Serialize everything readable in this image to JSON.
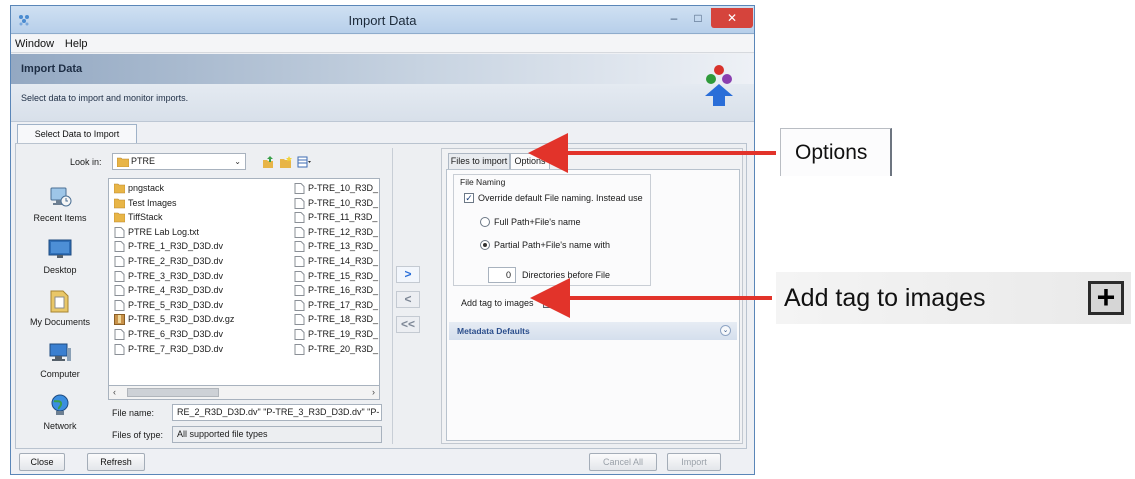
{
  "window": {
    "title": "Import Data",
    "controls": {
      "minimize": "–",
      "maximize": "□",
      "close": "✕"
    }
  },
  "menubar": {
    "items": [
      "Window",
      "Help"
    ]
  },
  "banner": {
    "title": "Import Data",
    "subtitle": "Select data to import and monitor imports."
  },
  "main_tab": {
    "label": "Select Data to Import"
  },
  "chooser": {
    "look_in_label": "Look in:",
    "look_in_value": "PTRE",
    "places": [
      "Recent Items",
      "Desktop",
      "My Documents",
      "Computer",
      "Network"
    ],
    "files_col1": [
      {
        "name": "pngstack",
        "icon": "folder-icon"
      },
      {
        "name": "Test Images",
        "icon": "folder-icon"
      },
      {
        "name": "TiffStack",
        "icon": "folder-icon"
      },
      {
        "name": "PTRE Lab Log.txt",
        "icon": "file-icon"
      },
      {
        "name": "P-TRE_1_R3D_D3D.dv",
        "icon": "file-icon"
      },
      {
        "name": "P-TRE_2_R3D_D3D.dv",
        "icon": "file-icon"
      },
      {
        "name": "P-TRE_3_R3D_D3D.dv",
        "icon": "file-icon"
      },
      {
        "name": "P-TRE_4_R3D_D3D.dv",
        "icon": "file-icon"
      },
      {
        "name": "P-TRE_5_R3D_D3D.dv",
        "icon": "file-icon"
      },
      {
        "name": "P-TRE_5_R3D_D3D.dv.gz",
        "icon": "archive-icon"
      },
      {
        "name": "P-TRE_6_R3D_D3D.dv",
        "icon": "file-icon"
      },
      {
        "name": "P-TRE_7_R3D_D3D.dv",
        "icon": "file-icon"
      }
    ],
    "files_col2": [
      "P-TRE_10_R3D_",
      "P-TRE_10_R3D_",
      "P-TRE_11_R3D_",
      "P-TRE_12_R3D_",
      "P-TRE_13_R3D_",
      "P-TRE_14_R3D_",
      "P-TRE_15_R3D_",
      "P-TRE_16_R3D_",
      "P-TRE_17_R3D_",
      "P-TRE_18_R3D_",
      "P-TRE_19_R3D_",
      "P-TRE_20_R3D_"
    ],
    "file_name_label": "File name:",
    "file_name_value": "RE_2_R3D_D3D.dv\" \"P-TRE_3_R3D_D3D.dv\" \"P-",
    "file_type_label": "Files of type:",
    "file_type_value": "All supported file types"
  },
  "transfer_buttons": {
    "add": ">",
    "remove": "<",
    "remove_all": "<<"
  },
  "options_panel": {
    "tabs": [
      "Files to import",
      "Options"
    ],
    "group_title": "File Naming",
    "override_label": "Override default File naming. Instead use",
    "override_checked": true,
    "radio_full": "Full Path+File's name",
    "radio_partial": "Partial Path+File's name with",
    "selected_radio": "partial",
    "dirs_value": "0",
    "dirs_label": "Directories before File",
    "add_tag_label": "Add tag to images",
    "add_tag_button": "+",
    "metadata_label": "Metadata Defaults",
    "metadata_toggle": "⌄"
  },
  "bottom_buttons": {
    "close": "Close",
    "refresh": "Refresh",
    "cancel_all": "Cancel All",
    "import": "Import"
  },
  "callouts": {
    "options": "Options",
    "add_tag": "Add tag to images",
    "add_tag_plus": "+"
  },
  "colors": {
    "arrow": "#e2332a",
    "accent_blue": "#2a6ed8",
    "close_button": "#d5443c"
  }
}
